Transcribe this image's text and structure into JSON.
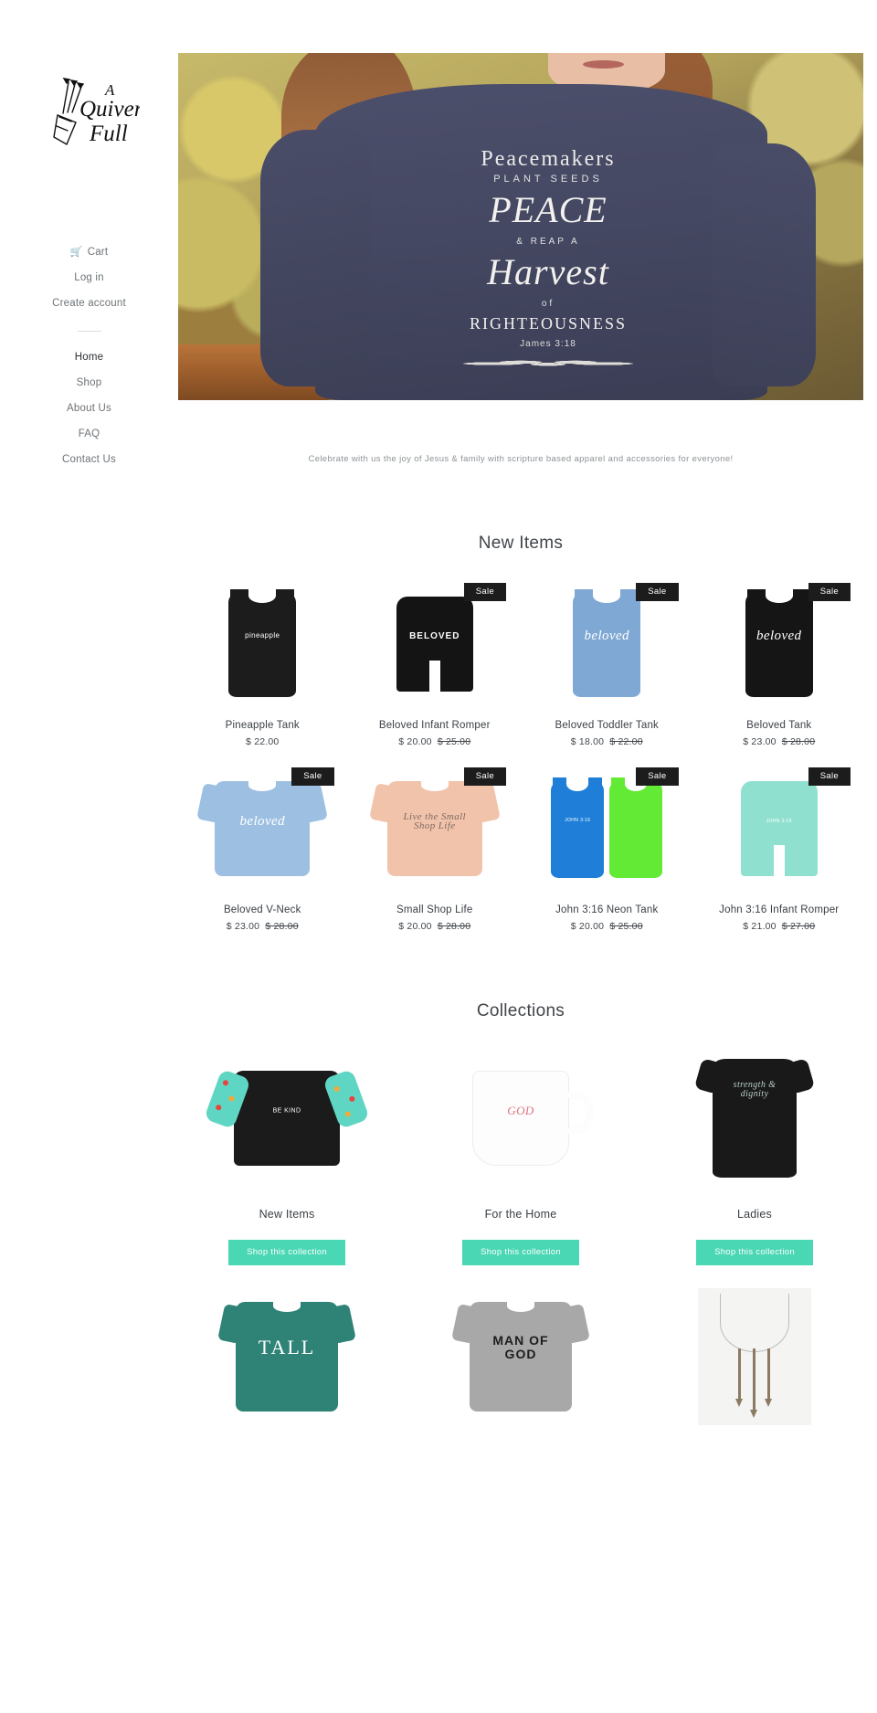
{
  "brand": {
    "name": "A Quiver Full",
    "logo_line_1": "A",
    "logo_line_2": "Quiver",
    "logo_line_3": "Full"
  },
  "sidebar": {
    "account_links": [
      {
        "label": "Cart",
        "icon": "shopping-cart-icon",
        "active": false
      },
      {
        "label": "Log in",
        "icon": null,
        "active": false
      },
      {
        "label": "Create account",
        "icon": null,
        "active": false
      }
    ],
    "main_links": [
      {
        "label": "Home",
        "active": true
      },
      {
        "label": "Shop",
        "active": false
      },
      {
        "label": "About Us",
        "active": false
      },
      {
        "label": "FAQ",
        "active": false
      },
      {
        "label": "Contact Us",
        "active": false
      }
    ]
  },
  "hero": {
    "alt": "Woman wearing navy Peacemakers sweatshirt",
    "line1": "Peacemakers",
    "line2": "PLANT SEEDS",
    "line3": "PEACE",
    "line4": "& REAP A",
    "line5": "Harvest",
    "line6": "of",
    "line7": "RIGHTEOUSNESS",
    "verse": "James 3:18"
  },
  "tagline": "Celebrate with us the joy of Jesus & family with scripture based apparel and accessories for everyone!",
  "sections": {
    "new_items_heading": "New Items",
    "collections_heading": "Collections"
  },
  "sale_badge_label": "Sale",
  "products": [
    {
      "title": "Pineapple Tank",
      "price": "$ 22.00",
      "compare_at": "",
      "on_sale": false,
      "garment": "tank",
      "color": "#1c1c1c",
      "print_color": "#ffffff",
      "print": "pineapple"
    },
    {
      "title": "Beloved Infant Romper",
      "price": "$ 20.00",
      "compare_at": "$ 25.00",
      "on_sale": true,
      "garment": "romper",
      "color": "#141414",
      "print_color": "#ffffff",
      "print": "BELOVED"
    },
    {
      "title": "Beloved Toddler Tank",
      "price": "$ 18.00",
      "compare_at": "$ 22.00",
      "on_sale": true,
      "garment": "tank",
      "color": "#7fa8d4",
      "print_color": "#ffffff",
      "print": "beloved"
    },
    {
      "title": "Beloved Tank",
      "price": "$ 23.00",
      "compare_at": "$ 28.00",
      "on_sale": true,
      "garment": "tank",
      "color": "#151515",
      "print_color": "#ffffff",
      "print": "beloved"
    },
    {
      "title": "Beloved V-Neck",
      "price": "$ 23.00",
      "compare_at": "$ 28.00",
      "on_sale": true,
      "garment": "tee",
      "color": "#9dc0e2",
      "print_color": "#ffffff",
      "print": "beloved"
    },
    {
      "title": "Small Shop Life",
      "price": "$ 20.00",
      "compare_at": "$ 28.00",
      "on_sale": true,
      "garment": "tee",
      "color": "#f2c3ab",
      "print_color": "#7a6b60",
      "print": "Live the Small Shop Life"
    },
    {
      "title": "John 3:16 Neon Tank",
      "price": "$ 20.00",
      "compare_at": "$ 25.00",
      "on_sale": true,
      "garment": "tank",
      "color": "#1f7fd8",
      "print_color": "#ffffff",
      "print": "JOHN 3:16"
    },
    {
      "title": "John 3:16 Infant Romper",
      "price": "$ 21.00",
      "compare_at": "$ 27.00",
      "on_sale": true,
      "garment": "romper",
      "color": "#8fe0cf",
      "print_color": "#ffffff",
      "print": "JOHN 3:16"
    }
  ],
  "collections": [
    {
      "title": "New Items",
      "button_label": "Shop this collection",
      "thumb": "kids-raglan-be-kind",
      "print": "BE KIND"
    },
    {
      "title": "For the Home",
      "button_label": "Shop this collection",
      "thumb": "white-coffee-mug-with-god",
      "print": "GOD"
    },
    {
      "title": "Ladies",
      "button_label": "Shop this collection",
      "thumb": "black-strength-and-dignity-dress",
      "print": "strength & dignity"
    },
    {
      "title": "",
      "button_label": "",
      "thumb": "teal-dino-tall-tee",
      "print": "TALL"
    },
    {
      "title": "",
      "button_label": "",
      "thumb": "grey-man-of-god-tee",
      "print": "MAN OF GOD"
    },
    {
      "title": "",
      "button_label": "",
      "thumb": "arrow-necklace",
      "print": ""
    }
  ],
  "colors": {
    "accent_mint": "#4ad7b4",
    "sale_badge_bg": "#1c1c1c",
    "text_primary": "#3b4045",
    "text_muted": "#8d9296"
  }
}
